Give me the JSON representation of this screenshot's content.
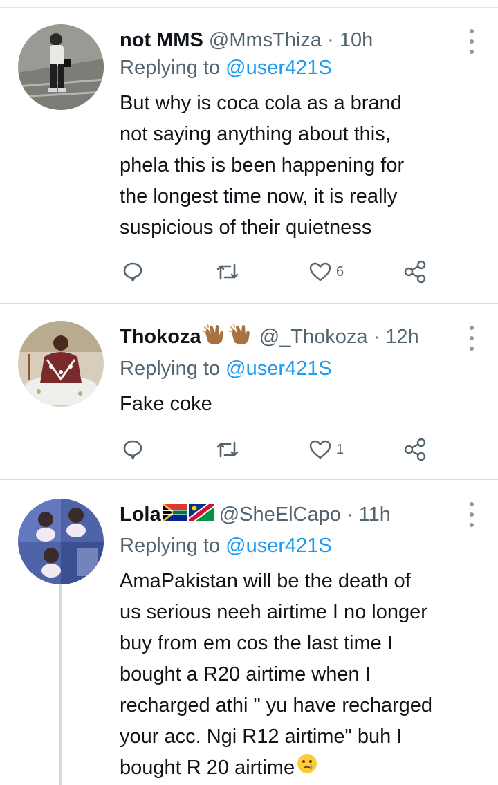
{
  "tweets": [
    {
      "name": "not MMS",
      "handle": "@MmsThiza",
      "separator": "·",
      "time": "10h",
      "replying_prefix": "Replying to",
      "replying_to": "@user421S",
      "text_lines": [
        "But why is coca cola as a brand",
        "not saying anything about this,",
        "phela this is been happening for",
        "the longest time now, it is really",
        "suspicious of their quietness"
      ],
      "likes": "6",
      "name_emoji": [],
      "colors": {
        "avatar_bg": "#8a8a86",
        "avatar_fg": "#2b2b2b"
      }
    },
    {
      "name": "Thokoza",
      "handle": "@_Thokoza",
      "separator": "·",
      "time": "12h",
      "replying_prefix": "Replying to",
      "replying_to": "@user421S",
      "text_lines": [
        "Fake coke"
      ],
      "likes": "1",
      "name_emoji": [
        "clapping-hands-emoji",
        "clapping-hands-emoji"
      ],
      "colors": {
        "avatar_bg": "#d9ccb8",
        "avatar_fg": "#6b3a2a"
      }
    },
    {
      "name": "Lola",
      "handle": "@SheElCapo",
      "separator": "·",
      "time": "11h",
      "replying_prefix": "Replying to",
      "replying_to": "@user421S",
      "text_lines": [
        "AmaPakistan will be the death of",
        "us serious neeh airtime I no longer",
        "buy from em cos the last time I",
        "bought a R20 airtime when I",
        "recharged athi \" yu have recharged",
        "your acc. Ngi R12 airtime\" buh I",
        "bought R 20 airtime"
      ],
      "likes": "",
      "name_emoji": [
        "south-africa-flag-emoji",
        "namibia-flag-emoji"
      ],
      "text_end_emoji": "crying-face-emoji",
      "colors": {
        "avatar_bg": "#5b6fb0",
        "avatar_fg": "#e8e0f0"
      }
    }
  ],
  "colors": {
    "mention": "#1d9bf0",
    "secondary": "#536471",
    "text": "#0f1419",
    "divider": "#dcdcdc"
  }
}
